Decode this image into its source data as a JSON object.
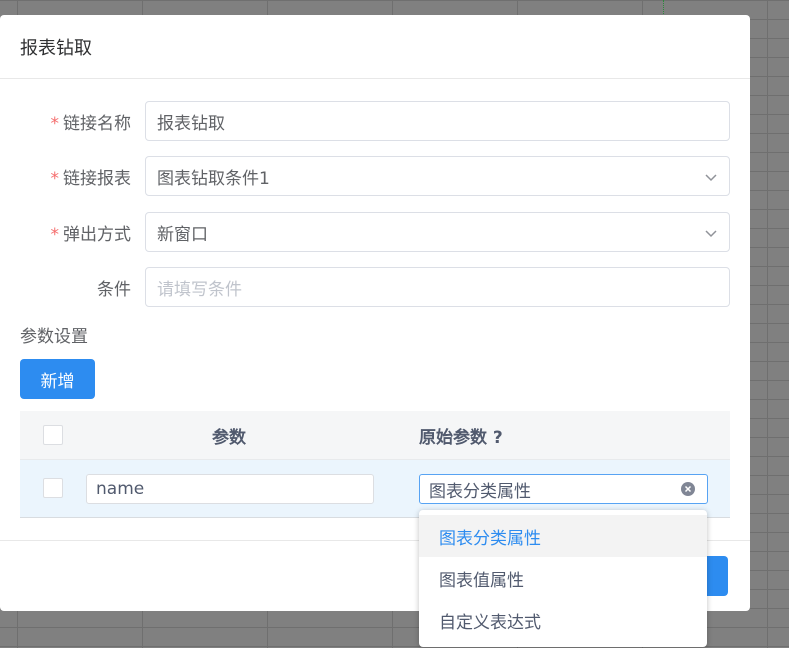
{
  "dialog": {
    "title": "报表钻取"
  },
  "form": {
    "link_name": {
      "label": "链接名称",
      "value": "报表钻取",
      "required": true
    },
    "link_report": {
      "label": "链接报表",
      "value": "图表钻取条件1",
      "required": true
    },
    "popup_mode": {
      "label": "弹出方式",
      "value": "新窗口",
      "required": true
    },
    "condition": {
      "label": "条件",
      "placeholder": "请填写条件"
    },
    "required_mark": "*"
  },
  "params": {
    "section_title": "参数设置",
    "add_label": "新增",
    "columns": {
      "param": "参数",
      "original": "原始参数 ?"
    },
    "rows": [
      {
        "param": "name",
        "original": "图表分类属性"
      }
    ]
  },
  "dropdown": {
    "options": [
      "图表分类属性",
      "图表值属性",
      "自定义表达式"
    ],
    "selected_index": 0
  },
  "colors": {
    "primary": "#2d8cf0",
    "required": "#f56c6c",
    "row_highlight": "#ebf5fd"
  },
  "icons": {
    "select_arrow": "chevron-down-icon",
    "clear": "clear-circle-icon"
  }
}
